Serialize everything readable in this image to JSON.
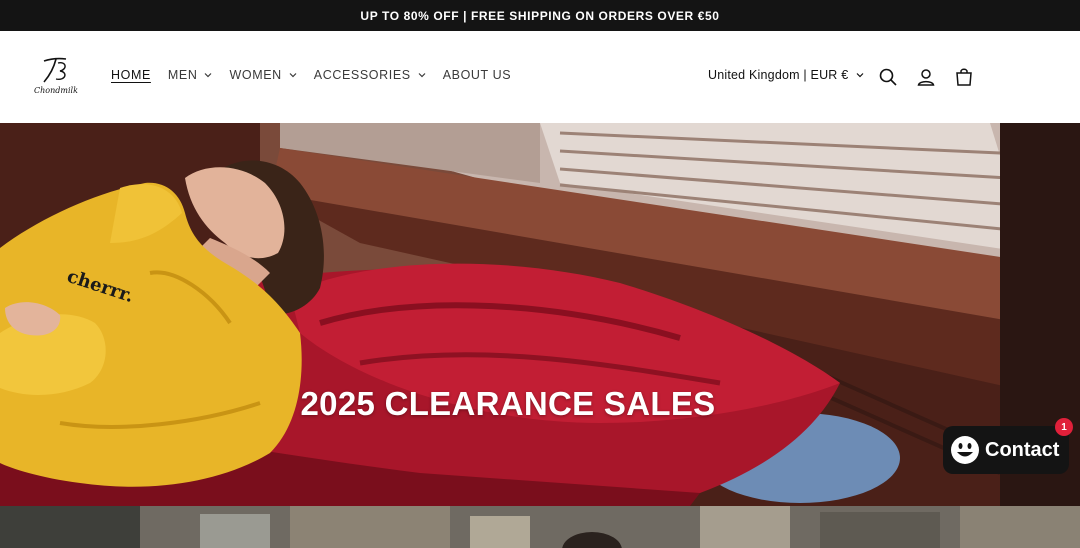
{
  "announcement": {
    "text": "UP TO 80% OFF | FREE SHIPPING ON ORDERS OVER €50"
  },
  "brand": {
    "name": "Chondmilk"
  },
  "nav": {
    "items": [
      {
        "label": "HOME",
        "active": true,
        "dropdown": false
      },
      {
        "label": "MEN",
        "active": false,
        "dropdown": true
      },
      {
        "label": "WOMEN",
        "active": false,
        "dropdown": true
      },
      {
        "label": "ACCESSORIES",
        "active": false,
        "dropdown": true
      },
      {
        "label": "ABOUT US",
        "active": false,
        "dropdown": false
      }
    ]
  },
  "header": {
    "locale": "United Kingdom | EUR €",
    "icons": [
      "search-icon",
      "account-icon",
      "cart-icon"
    ]
  },
  "hero": {
    "title": "2025 CLEARANCE SALES",
    "sweatshirt_print": "cherrr."
  },
  "contact": {
    "label": "Contact",
    "badge": "1"
  },
  "colors": {
    "announcement_bg": "#141414",
    "badge": "#e0203a",
    "pillow": "#a8162a",
    "sweatshirt": "#e8b528"
  }
}
